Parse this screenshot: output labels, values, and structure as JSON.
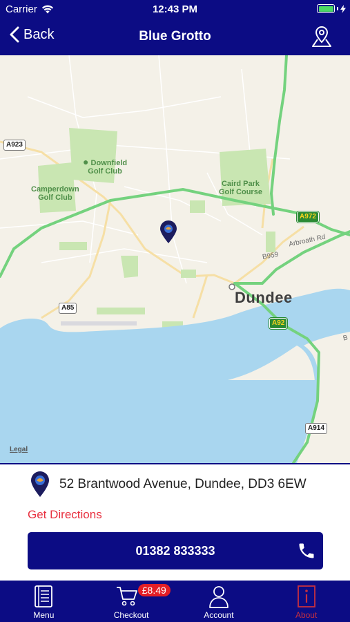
{
  "status": {
    "carrier": "Carrier",
    "time": "12:43 PM"
  },
  "nav": {
    "back_label": "Back",
    "title": "Blue Grotto"
  },
  "map": {
    "city": "Dundee",
    "legal": "Legal",
    "places": {
      "downfield": "Downfield\nGolf Club",
      "camperdown": "Camperdown\nGolf Club",
      "caird": "Caird Park\nGolf Course"
    },
    "roads": {
      "a923": "A923",
      "a972": "A972",
      "a85": "A85",
      "a92": "A92",
      "a914": "A914",
      "b959": "B959",
      "arbroath": "Arbroath Rd",
      "b_partial": "B"
    }
  },
  "info": {
    "address": "52 Brantwood Avenue, Dundee, DD3 6EW",
    "directions_label": "Get Directions",
    "phone": "01382 833333"
  },
  "tabs": [
    {
      "label": "Menu",
      "icon": "menu-book-icon"
    },
    {
      "label": "Checkout",
      "icon": "cart-icon",
      "badge": "£8.49"
    },
    {
      "label": "Account",
      "icon": "person-icon"
    },
    {
      "label": "About",
      "icon": "info-icon"
    }
  ],
  "colors": {
    "brand": "#0c0c84",
    "accent": "#e8303f",
    "badge": "#e41e26"
  }
}
